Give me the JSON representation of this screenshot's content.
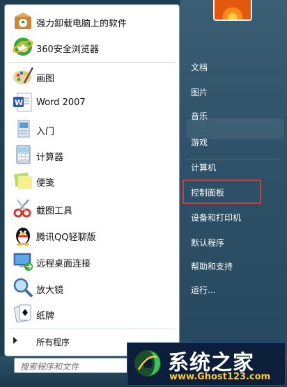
{
  "pinned": [
    {
      "label": "强力卸载电脑上的软件",
      "icon": "uninstall-box-icon"
    },
    {
      "label": "360安全浏览器",
      "icon": "browser-360-icon"
    }
  ],
  "recent": [
    {
      "label": "画图",
      "icon": "paint-palette-icon"
    },
    {
      "label": "Word 2007",
      "icon": "word-icon"
    },
    {
      "label": "入门",
      "icon": "getting-started-icon"
    },
    {
      "label": "计算器",
      "icon": "calculator-icon"
    },
    {
      "label": "便笺",
      "icon": "sticky-notes-icon"
    },
    {
      "label": "截图工具",
      "icon": "snipping-tool-icon"
    },
    {
      "label": "腾讯QQ轻聊版",
      "icon": "qq-penguin-icon"
    },
    {
      "label": "远程桌面连接",
      "icon": "remote-desktop-icon"
    },
    {
      "label": "放大镜",
      "icon": "magnifier-icon"
    },
    {
      "label": "纸牌",
      "icon": "solitaire-icon"
    }
  ],
  "all_programs": "所有程序",
  "search": {
    "placeholder": "搜索程序和文件"
  },
  "right_items": [
    {
      "label": "文档"
    },
    {
      "label": "图片"
    },
    {
      "label": "音乐"
    },
    {
      "label": "游戏"
    },
    {
      "label": "计算机"
    },
    {
      "label": "控制面板"
    },
    {
      "label": "设备和打印机"
    },
    {
      "label": "默认程序"
    },
    {
      "label": "帮助和支持"
    },
    {
      "label": "运行..."
    }
  ],
  "watermark": {
    "title": "系统之家",
    "url": "www.Ghost123.com"
  },
  "colors": {
    "highlight_border": "#d23c3c",
    "right_panel": "#2e5168"
  }
}
